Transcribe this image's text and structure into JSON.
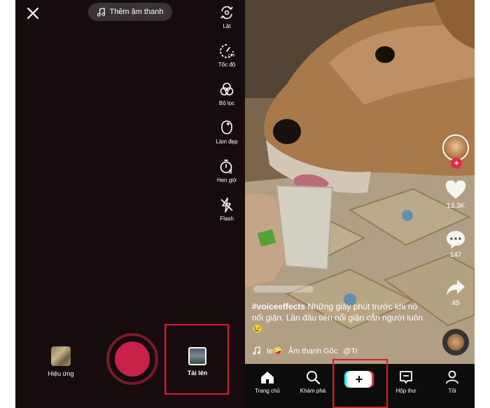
{
  "camera": {
    "add_sound_label": "Thêm âm thanh",
    "tools": [
      {
        "icon": "flip-camera-icon",
        "label": "Lật"
      },
      {
        "icon": "speed-icon",
        "label": "Tốc độ"
      },
      {
        "icon": "filters-icon",
        "label": "Bộ lọc"
      },
      {
        "icon": "beautify-icon",
        "label": "Làm đẹp"
      },
      {
        "icon": "timer-icon",
        "label": "Hẹn giờ"
      },
      {
        "icon": "flash-off-icon",
        "label": "Flash"
      }
    ],
    "effects_label": "Hiệu ứng",
    "upload_label": "Tải lên",
    "accent_color": "#c6224a",
    "highlight_color": "#e0182d"
  },
  "feed": {
    "likes": "13.3K",
    "comments": "147",
    "shares": "45",
    "caption_hashtag": "#voiceeffects",
    "caption_text": "Những giây phút trước khi nó nổi giận. Lần đầu tiên nổi giận cắn người luôn 😢",
    "sound_user": "te🤪",
    "sound_name": "Âm thanh Gốc",
    "sound_credit": "@Tr",
    "tabs": [
      {
        "icon": "home-icon",
        "label": "Trang chủ"
      },
      {
        "icon": "search-icon",
        "label": "Khám phá"
      },
      {
        "icon": "create-icon",
        "label": "+"
      },
      {
        "icon": "inbox-icon",
        "label": "Hộp thư"
      },
      {
        "icon": "profile-icon",
        "label": "Tôi"
      }
    ],
    "create_label": "+"
  }
}
